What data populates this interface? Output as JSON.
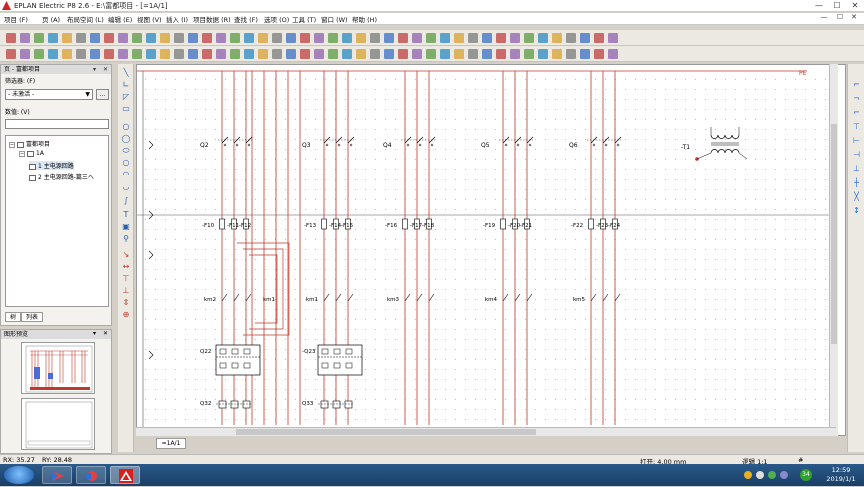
{
  "window": {
    "title": "EPLAN Electric P8 2.6 - E:\\富都项目 - [=1A/1]",
    "min": "—",
    "max": "☐",
    "close": "✕"
  },
  "menu": {
    "items": [
      "项目 (F)",
      "页 (A)",
      "布局空间 (L)",
      "编辑 (E)",
      "视图 (V)",
      "插入 (I)",
      "项目数据 (R)",
      "查找 (F)",
      "选项 (O)",
      "工具 (T)",
      "窗口 (W)",
      "帮助 (H)"
    ]
  },
  "page_panel": {
    "title": "页 - 富都项目",
    "filter_label": "筛选器: (F)",
    "filter_value": "- 未激活 -",
    "dots": "...",
    "value_label": "数值: (V)",
    "tree": {
      "root": "富都项目",
      "node1": "1A",
      "page1": "1 主电源回路",
      "page2": "2 主电源回路-篇三ヘ"
    },
    "tab_tree": "树",
    "tab_list": "列表"
  },
  "preview_panel": {
    "title": "图形预览"
  },
  "canvas": {
    "page_tab": "=1A/1",
    "corner_label": "PE",
    "contactors": [
      "Q2",
      "Q3",
      "Q4",
      "Q5",
      "Q6"
    ],
    "transformer": "-T1",
    "fuse_groups": [
      [
        "-F10",
        "-F11",
        "-F12"
      ],
      [
        "-F13",
        "-F14",
        "-F15"
      ],
      [
        "-F16",
        "-F17",
        "-F18"
      ],
      [
        "-F19",
        "-F20",
        "-F21"
      ],
      [
        "-F22",
        "-F23",
        "-F24"
      ]
    ],
    "km_labels": [
      "km2",
      "km1",
      "km3",
      "km4",
      "km5"
    ],
    "breakers": [
      "Q22",
      "-Q23"
    ],
    "bottom_devices": [
      "Q32",
      "Q33"
    ]
  },
  "status": {
    "rx": "RX: 35.27",
    "ry": "RY: 28.48",
    "open": "打开: 4.00 mm",
    "logic": "逻辑 1:1",
    "hash": "#"
  },
  "taskbar": {
    "time": "12:59",
    "date": "2019/1/1",
    "tray_number": "34"
  },
  "colors": {
    "wire": "#c0392b",
    "blue_wire": "#2a5db0",
    "grid": "#9a9a9a"
  }
}
